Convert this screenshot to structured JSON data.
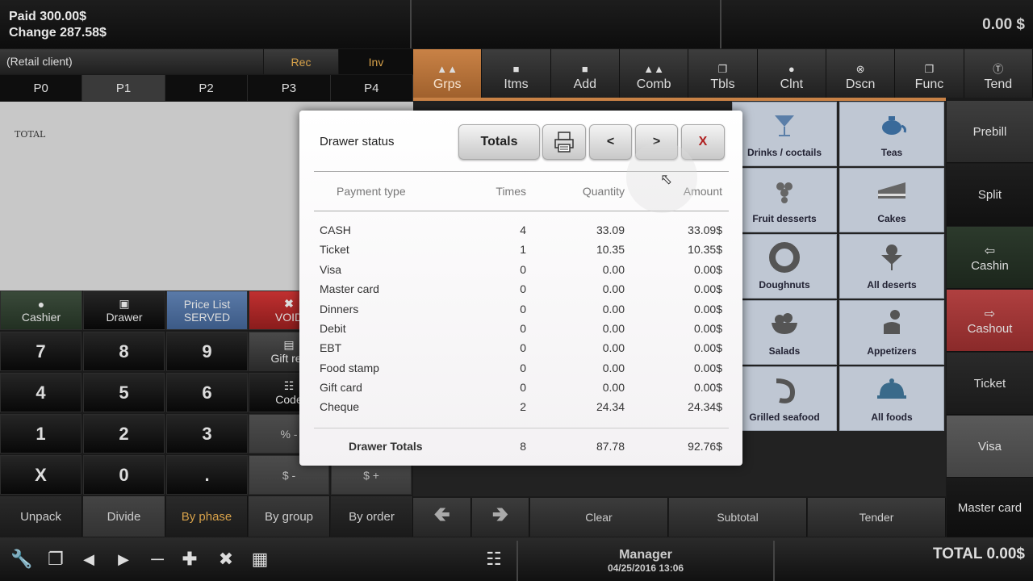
{
  "header": {
    "paid": "Paid 300.00$",
    "change": "Change 287.58$",
    "total": "0.00 $"
  },
  "client": {
    "name": "(Retail client)",
    "rec": "Rec",
    "inv": "Inv"
  },
  "price_levels": [
    "P0",
    "P1",
    "P2",
    "P3",
    "P4"
  ],
  "ticket": {
    "total_label": "TOTAL"
  },
  "func_buttons": {
    "cashier": "Cashier",
    "drawer": "Drawer",
    "price_list": "Price List",
    "price_list_sub": "SERVED",
    "void": "VOID",
    "gift_rec": "Gift rec",
    "code": "Code",
    "percent": "% -",
    "dollar_minus": "$ -",
    "dollar_plus": "$ +"
  },
  "keys": [
    "7",
    "8",
    "9",
    "4",
    "5",
    "6",
    "1",
    "2",
    "3",
    "X",
    "0",
    "."
  ],
  "bottom_left": {
    "unpack": "Unpack",
    "divide": "Divide",
    "by_phase": "By phase",
    "by_group": "By group",
    "by_order": "By order"
  },
  "nav_tabs": [
    "Grps",
    "Itms",
    "Add",
    "Comb",
    "Tbls",
    "Clnt",
    "Dscn",
    "Func",
    "Tend"
  ],
  "tiles": [
    "Drinks / coctails",
    "Teas",
    "Fruit desserts",
    "Cakes",
    "Doughnuts",
    "All deserts",
    "Salads",
    "Appetizers",
    "Grilled seafood",
    "All foods"
  ],
  "right_buttons": [
    "Prebill",
    "Split",
    "Cashin",
    "Cashout",
    "Ticket",
    "Visa",
    "Master card"
  ],
  "action_bar": {
    "clear": "Clear",
    "subtotal": "Subtotal",
    "tender": "Tender"
  },
  "status": {
    "user": "Manager",
    "datetime": "04/25/2016  13:06",
    "total": "TOTAL 0.00$"
  },
  "modal": {
    "title": "Drawer status",
    "totals_btn": "Totals",
    "prev": "<",
    "next": ">",
    "close": "X",
    "headers": {
      "type": "Payment type",
      "times": "Times",
      "quantity": "Quantity",
      "amount": "Amount"
    },
    "rows": [
      {
        "type": "CASH",
        "times": "4",
        "quantity": "33.09",
        "amount": "33.09$"
      },
      {
        "type": "Ticket",
        "times": "1",
        "quantity": "10.35",
        "amount": "10.35$"
      },
      {
        "type": "Visa",
        "times": "0",
        "quantity": "0.00",
        "amount": "0.00$"
      },
      {
        "type": "Master card",
        "times": "0",
        "quantity": "0.00",
        "amount": "0.00$"
      },
      {
        "type": "Dinners",
        "times": "0",
        "quantity": "0.00",
        "amount": "0.00$"
      },
      {
        "type": "Debit",
        "times": "0",
        "quantity": "0.00",
        "amount": "0.00$"
      },
      {
        "type": "EBT",
        "times": "0",
        "quantity": "0.00",
        "amount": "0.00$"
      },
      {
        "type": "Food stamp",
        "times": "0",
        "quantity": "0.00",
        "amount": "0.00$"
      },
      {
        "type": "Gift card",
        "times": "0",
        "quantity": "0.00",
        "amount": "0.00$"
      },
      {
        "type": "Cheque",
        "times": "2",
        "quantity": "24.34",
        "amount": "24.34$"
      }
    ],
    "totals": {
      "label": "Drawer Totals",
      "times": "8",
      "quantity": "87.78",
      "amount": "92.76$"
    }
  }
}
